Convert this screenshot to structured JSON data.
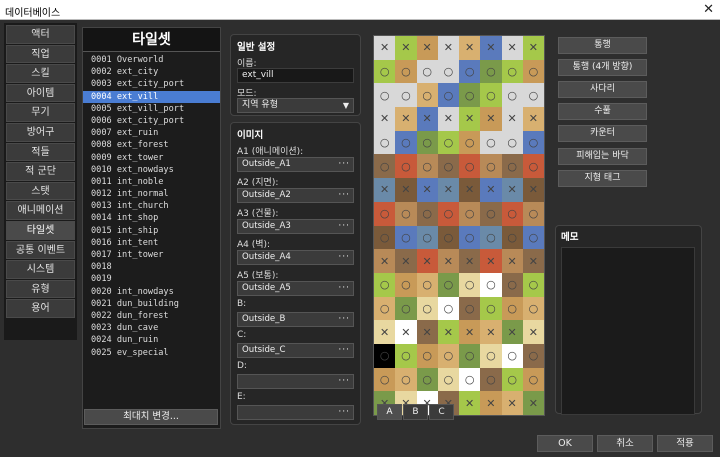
{
  "window": {
    "title": "데이터베이스",
    "close_glyph": "✕"
  },
  "categories": [
    "액터",
    "직업",
    "스킬",
    "아이템",
    "무기",
    "방어구",
    "적들",
    "적 군단",
    "스탯",
    "애니메이션",
    "타일셋",
    "공통 이벤트",
    "시스템",
    "유형",
    "용어"
  ],
  "selected_category": 10,
  "list": {
    "title": "타일셋",
    "selected": 3,
    "change_max_label": "최대치 변경...",
    "items": [
      "0001 Overworld",
      "0002 ext_city",
      "0003 ext_city_port",
      "0004 ext_vill",
      "0005 ext_vill_port",
      "0006 ext_city_port",
      "0007 ext_ruin",
      "0008 ext_forest",
      "0009 ext_tower",
      "0010 ext_nowdays",
      "0011 int_noble",
      "0012 int_normal",
      "0013 int_church",
      "0014 int_shop",
      "0015 int_ship",
      "0016 int_tent",
      "0017 int_tower",
      "0018",
      "0019",
      "0020 int_nowdays",
      "0021 dun_building",
      "0022 dun_forest",
      "0023 dun_cave",
      "0024 dun_ruin",
      "0025 ev_special"
    ]
  },
  "general": {
    "title": "일반 설정",
    "name_label": "이름:",
    "name_value": "ext_vill",
    "mode_label": "모드:",
    "mode_value": "지역 유형"
  },
  "images": {
    "title": "이미지",
    "slots": [
      {
        "label": "A1 (애니메이션):",
        "value": "Outside_A1"
      },
      {
        "label": "A2 (지면):",
        "value": "Outside_A2"
      },
      {
        "label": "A3 (건물):",
        "value": "Outside_A3"
      },
      {
        "label": "A4 (벽):",
        "value": "Outside_A4"
      },
      {
        "label": "A5 (보통):",
        "value": "Outside_A5"
      },
      {
        "label": "B:",
        "value": "Outside_B"
      },
      {
        "label": "C:",
        "value": "Outside_C"
      },
      {
        "label": "D:",
        "value": ""
      },
      {
        "label": "E:",
        "value": ""
      }
    ],
    "browse_glyph": "···"
  },
  "tile_tabs": [
    "A",
    "B",
    "C"
  ],
  "selected_tab": 0,
  "flag_buttons": [
    "통행",
    "통행 (4개 방향)",
    "사다리",
    "수풀",
    "카운터",
    "피해입는 바닥",
    "지형 태그"
  ],
  "memo": {
    "title": "메모",
    "value": ""
  },
  "footer": {
    "ok": "OK",
    "cancel": "취소",
    "apply": "적용"
  },
  "colors": {
    "selection": "#4a7dd3",
    "background": "#2e2e2e",
    "panel": "#262626"
  },
  "tile_markers": {
    "pass": "○",
    "block": "✕"
  }
}
